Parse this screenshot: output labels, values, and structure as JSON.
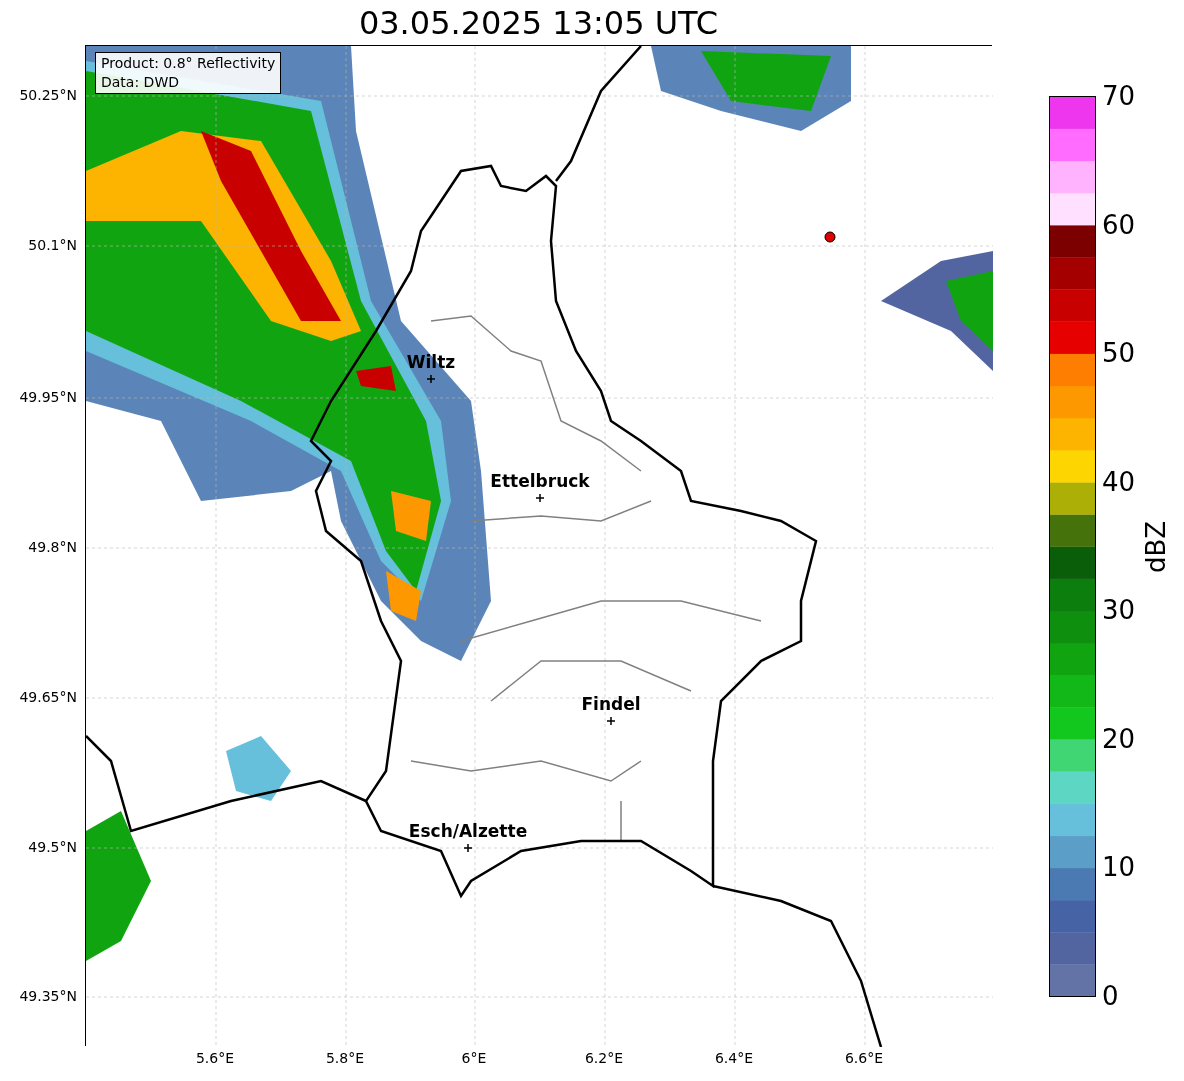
{
  "title": "03.05.2025 13:05 UTC",
  "legend": [
    "Product: 0.8° Reflectivity",
    "Data: DWD"
  ],
  "lat_ticks": [
    "50.25°N",
    "50.1°N",
    "49.95°N",
    "49.8°N",
    "49.65°N",
    "49.5°N",
    "49.35°N"
  ],
  "lon_ticks": [
    "5.6°E",
    "5.8°E",
    "6°E",
    "6.2°E",
    "6.4°E",
    "6.6°E"
  ],
  "cities": [
    {
      "name": "Wiltz"
    },
    {
      "name": "Ettelbruck"
    },
    {
      "name": "Findel"
    },
    {
      "name": "Esch/Alzette"
    }
  ],
  "colorbar": {
    "label": "dBZ",
    "ticks": [
      "70",
      "60",
      "50",
      "40",
      "30",
      "20",
      "10",
      "0"
    ],
    "bins": [
      {
        "color": "#6373a6"
      },
      {
        "color": "#5265a0"
      },
      {
        "color": "#4563a5"
      },
      {
        "color": "#4b79b2"
      },
      {
        "color": "#5b9fc9"
      },
      {
        "color": "#66bfdb"
      },
      {
        "color": "#5ed6c4"
      },
      {
        "color": "#40d673"
      },
      {
        "color": "#12c81e"
      },
      {
        "color": "#11b817"
      },
      {
        "color": "#10a510"
      },
      {
        "color": "#0e900e"
      },
      {
        "color": "#0b7e0d"
      },
      {
        "color": "#0a5e0a"
      },
      {
        "color": "#45720a"
      },
      {
        "color": "#acaf06"
      },
      {
        "color": "#fdd500"
      },
      {
        "color": "#fcb400"
      },
      {
        "color": "#fd9800"
      },
      {
        "color": "#fd7e00"
      },
      {
        "color": "#e60000"
      },
      {
        "color": "#c80000"
      },
      {
        "color": "#a50000"
      },
      {
        "color": "#7c0000"
      },
      {
        "color": "#ffe0ff"
      },
      {
        "color": "#ffb3ff"
      },
      {
        "color": "#ff6cff"
      },
      {
        "color": "#ee36ee"
      }
    ]
  }
}
